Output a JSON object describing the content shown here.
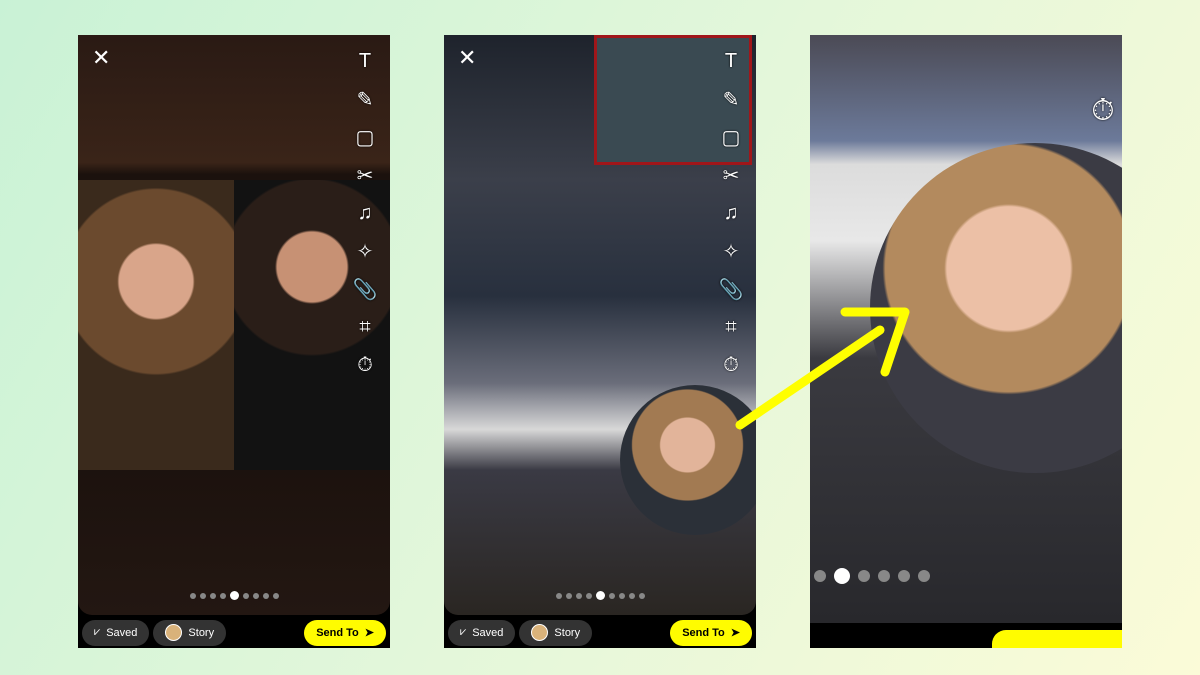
{
  "panels": [
    {
      "close_icon": "✕",
      "saved_label": "Saved",
      "story_label": "Story",
      "send_label": "Send To",
      "dots": 9,
      "active_dot": 4
    },
    {
      "close_icon": "✕",
      "saved_label": "Saved",
      "story_label": "Story",
      "send_label": "Send To",
      "dots": 9,
      "active_dot": 4
    },
    {
      "dots": 6,
      "active_dot": 1
    }
  ],
  "tools": [
    "T",
    "✎",
    "▢",
    "✂",
    "♫",
    "✧",
    "📎",
    "⌗",
    "⏱"
  ],
  "tool_icons": [
    "text-icon",
    "pencil-icon",
    "sticker-icon",
    "scissors-icon",
    "music-icon",
    "lens-icon",
    "paperclip-icon",
    "crop-icon",
    "timer-icon"
  ],
  "colors": {
    "accent": "#fffc00",
    "arrow": "#ffff00"
  }
}
